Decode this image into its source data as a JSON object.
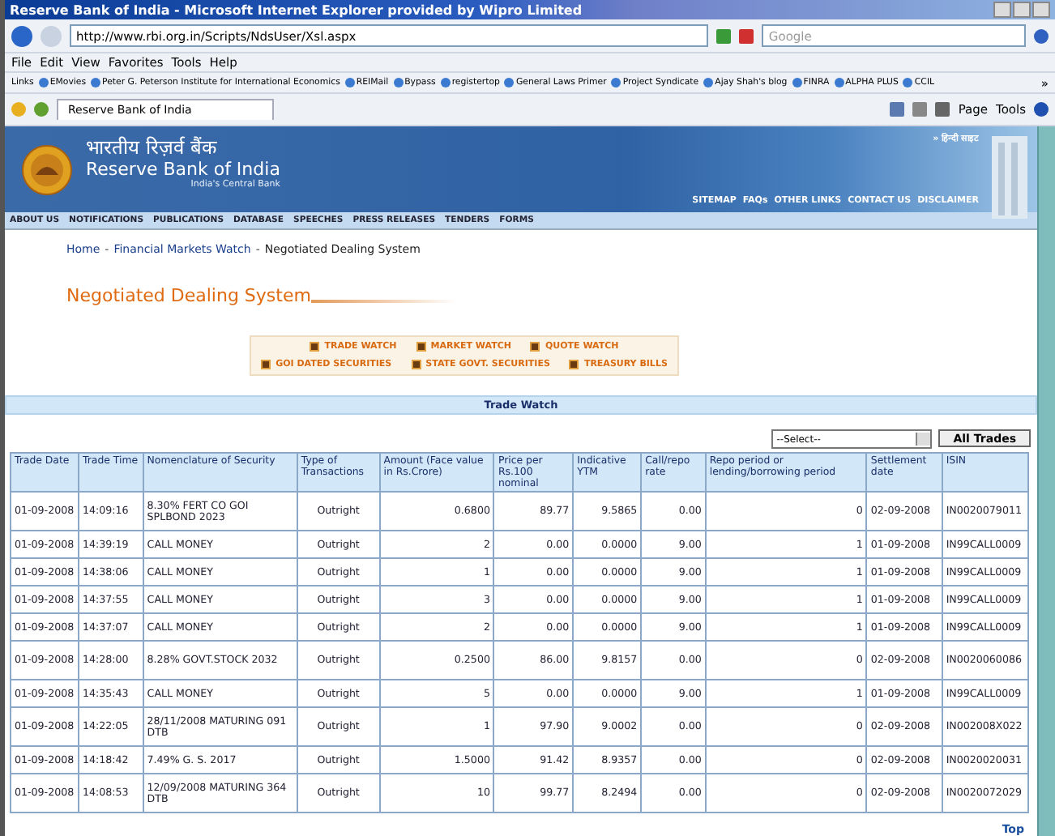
{
  "window": {
    "title": "Reserve Bank of India - Microsoft Internet Explorer provided by Wipro Limited"
  },
  "browser": {
    "address": "http://www.rbi.org.in/Scripts/NdsUser/Xsl.aspx",
    "search_placeholder": "Google",
    "menu": [
      "File",
      "Edit",
      "View",
      "Favorites",
      "Tools",
      "Help"
    ],
    "links_label": "Links",
    "bookmarks": [
      "EMovies",
      "Peter G. Peterson Institute for International Economics",
      "REIMail",
      "Bypass",
      "registertop",
      "General Laws Primer",
      "Project Syndicate",
      "Ajay Shah's blog",
      "FINRA",
      "ALPHA PLUS",
      "CCIL"
    ],
    "overflow": "»",
    "tab": "Reserve Bank of India",
    "commands": [
      "Page",
      "Tools"
    ]
  },
  "site": {
    "hindi_name": "भारतीय रिज़र्व बैंक",
    "name": "Reserve Bank of India",
    "tagline": "India's Central Bank",
    "hindi_link": "» हिन्दी साइट",
    "top_links": [
      "SITEMAP",
      "FAQs",
      "OTHER LINKS",
      "CONTACT US",
      "DISCLAIMER"
    ],
    "nav": [
      "ABOUT US",
      "NOTIFICATIONS",
      "PUBLICATIONS",
      "DATABASE",
      "SPEECHES",
      "PRESS RELEASES",
      "TENDERS",
      "FORMS"
    ]
  },
  "breadcrumb_separator": "-",
  "breadcrumb": [
    {
      "label": "Home",
      "link": true
    },
    {
      "label": "Financial Markets Watch",
      "link": true
    },
    {
      "label": "Negotiated Dealing System",
      "link": false
    }
  ],
  "page_title": "Negotiated Dealing System",
  "quick_links": [
    [
      "TRADE WATCH",
      "MARKET WATCH",
      "QUOTE WATCH"
    ],
    [
      "GOI DATED SECURITIES",
      "STATE GOVT. SECURITIES",
      "TREASURY BILLS"
    ]
  ],
  "section_title": "Trade Watch",
  "select": "--Select--",
  "button": "All Trades",
  "table": {
    "columns": [
      "Trade Date",
      "Trade Time",
      "Nomenclature of Security",
      "Type of Transactions",
      "Amount (Face value in Rs.Crore)",
      "Price per Rs.100 nominal",
      "Indicative YTM",
      "Call/repo rate",
      "Repo period or lending/borrowing period",
      "Settlement date",
      "ISIN"
    ],
    "rows": [
      [
        "01-09-2008",
        "14:09:16",
        "8.30% FERT CO GOI SPLBOND 2023",
        "Outright",
        "0.6800",
        "89.77",
        "9.5865",
        "0.00",
        "0",
        "02-09-2008",
        "IN0020079011"
      ],
      [
        "01-09-2008",
        "14:39:19",
        "CALL MONEY",
        "Outright",
        "2",
        "0.00",
        "0.0000",
        "9.00",
        "1",
        "01-09-2008",
        "IN99CALL0009"
      ],
      [
        "01-09-2008",
        "14:38:06",
        "CALL MONEY",
        "Outright",
        "1",
        "0.00",
        "0.0000",
        "9.00",
        "1",
        "01-09-2008",
        "IN99CALL0009"
      ],
      [
        "01-09-2008",
        "14:37:55",
        "CALL MONEY",
        "Outright",
        "3",
        "0.00",
        "0.0000",
        "9.00",
        "1",
        "01-09-2008",
        "IN99CALL0009"
      ],
      [
        "01-09-2008",
        "14:37:07",
        "CALL MONEY",
        "Outright",
        "2",
        "0.00",
        "0.0000",
        "9.00",
        "1",
        "01-09-2008",
        "IN99CALL0009"
      ],
      [
        "01-09-2008",
        "14:28:00",
        "8.28% GOVT.STOCK 2032",
        "Outright",
        "0.2500",
        "86.00",
        "9.8157",
        "0.00",
        "0",
        "02-09-2008",
        "IN0020060086"
      ],
      [
        "01-09-2008",
        "14:35:43",
        "CALL MONEY",
        "Outright",
        "5",
        "0.00",
        "0.0000",
        "9.00",
        "1",
        "01-09-2008",
        "IN99CALL0009"
      ],
      [
        "01-09-2008",
        "14:22:05",
        "28/11/2008 MATURING 091 DTB",
        "Outright",
        "1",
        "97.90",
        "9.0002",
        "0.00",
        "0",
        "02-09-2008",
        "IN002008X022"
      ],
      [
        "01-09-2008",
        "14:18:42",
        "7.49% G. S. 2017",
        "Outright",
        "1.5000",
        "91.42",
        "8.9357",
        "0.00",
        "0",
        "02-09-2008",
        "IN0020020031"
      ],
      [
        "01-09-2008",
        "14:08:53",
        "12/09/2008 MATURING 364 DTB",
        "Outright",
        "10",
        "99.77",
        "8.2494",
        "0.00",
        "0",
        "02-09-2008",
        "IN0020072029"
      ]
    ]
  },
  "footer_link": "Top"
}
